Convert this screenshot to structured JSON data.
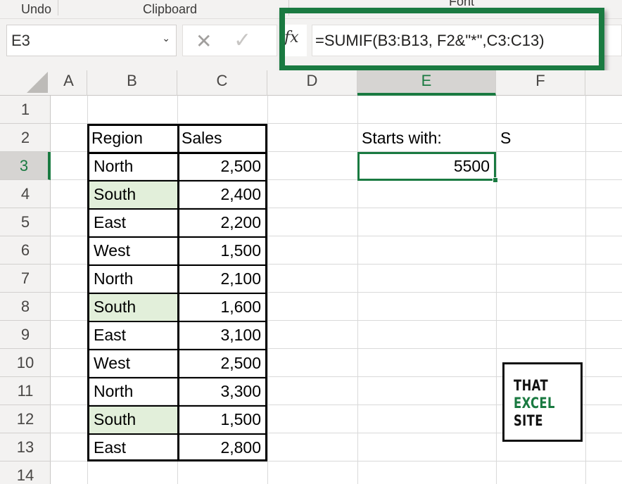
{
  "ribbon": {
    "groups": [
      "Undo",
      "Clipboard",
      "Font"
    ]
  },
  "formula_bar": {
    "name_box": "E3",
    "cancel_icon": "x-icon",
    "enter_icon": "check-icon",
    "fx_label": "fx",
    "formula": "=SUMIF(B3:B13, F2&\"*\",C3:C13)"
  },
  "grid": {
    "columns": [
      "A",
      "B",
      "C",
      "D",
      "E",
      "F"
    ],
    "rows": [
      "1",
      "2",
      "3",
      "4",
      "5",
      "6",
      "7",
      "8",
      "9",
      "10",
      "11",
      "12",
      "13",
      "14"
    ],
    "active_cell": "E3",
    "active_column": "E",
    "active_row": "3"
  },
  "table": {
    "headers": [
      "Region",
      "Sales"
    ],
    "rows": [
      {
        "region": "North",
        "sales": "2,500",
        "highlight": false
      },
      {
        "region": "South",
        "sales": "2,400",
        "highlight": true
      },
      {
        "region": "East",
        "sales": "2,200",
        "highlight": false
      },
      {
        "region": "West",
        "sales": "1,500",
        "highlight": false
      },
      {
        "region": "North",
        "sales": "2,100",
        "highlight": false
      },
      {
        "region": "South",
        "sales": "1,600",
        "highlight": true
      },
      {
        "region": "East",
        "sales": "3,100",
        "highlight": false
      },
      {
        "region": "West",
        "sales": "2,500",
        "highlight": false
      },
      {
        "region": "North",
        "sales": "3,300",
        "highlight": false
      },
      {
        "region": "South",
        "sales": "1,500",
        "highlight": true
      },
      {
        "region": "East",
        "sales": "2,800",
        "highlight": false
      }
    ],
    "highlight_color": "#e2efda"
  },
  "criteria": {
    "label": "Starts with:",
    "value": "S",
    "result": "5500"
  },
  "logo": {
    "lines": [
      "THAT",
      "EXCEL",
      "SITE"
    ],
    "colors": [
      "#111111",
      "#1a7a41",
      "#111111"
    ]
  },
  "colors": {
    "accent": "#1a7a41"
  }
}
